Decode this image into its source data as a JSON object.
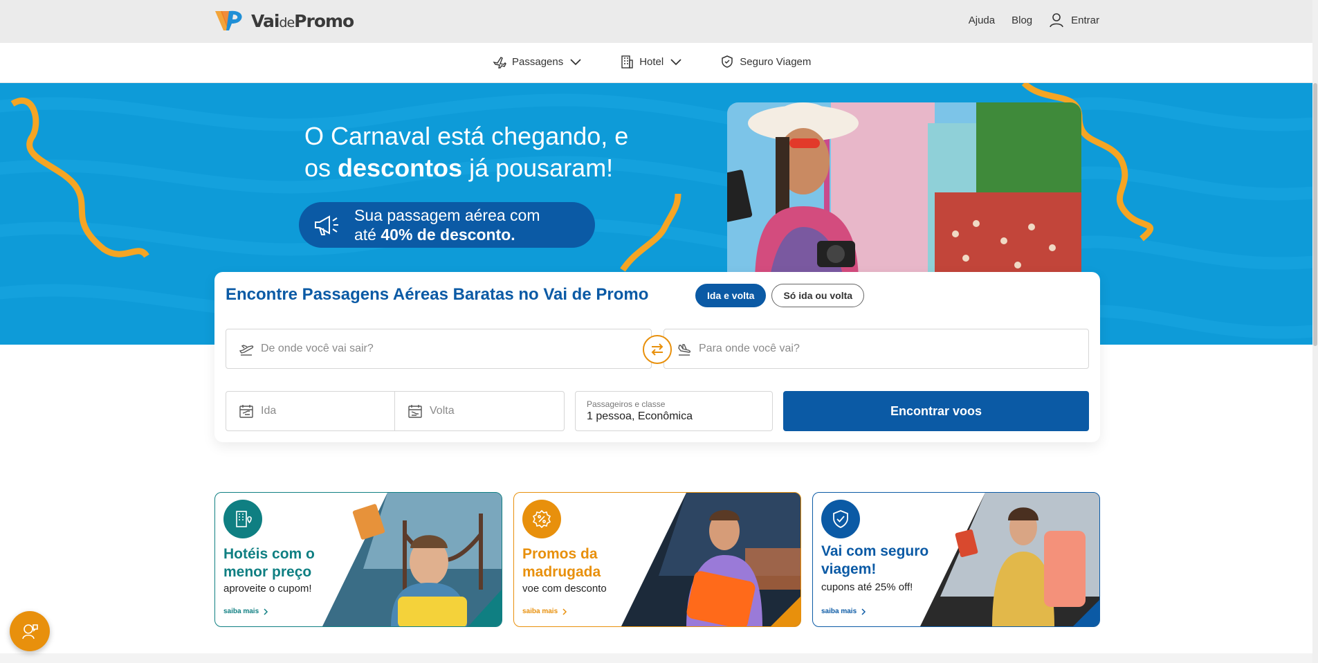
{
  "header": {
    "logo_text_vai": "Vai",
    "logo_text_de": "de",
    "logo_text_promo": "Promo",
    "links": {
      "ajuda": "Ajuda",
      "blog": "Blog",
      "entrar": "Entrar"
    }
  },
  "subnav": {
    "items": [
      {
        "label": "Passagens",
        "icon": "airplane-icon",
        "dropdown": true
      },
      {
        "label": "Hotel",
        "icon": "building-icon",
        "dropdown": true
      },
      {
        "label": "Seguro Viagem",
        "icon": "shield-icon",
        "dropdown": false
      }
    ]
  },
  "hero": {
    "title_line1": "O Carnaval está chegando, e",
    "title_line2_pre": "os ",
    "title_line2_bold": "descontos",
    "title_line2_post": " já pousaram!",
    "promo_line1": "Sua passagem aérea com",
    "promo_line2_pre": "até ",
    "promo_line2_bold": "40% de desconto.",
    "bg_color": "#0e9bd8"
  },
  "search": {
    "title": "Encontre Passagens Aéreas Baratas no Vai de Promo",
    "trip_types": {
      "round": "Ida e volta",
      "oneway": "Só ida ou volta"
    },
    "selected_trip": "round",
    "origin_placeholder": "De onde você vai sair?",
    "destination_placeholder": "Para onde você vai?",
    "depart_placeholder": "Ida",
    "return_placeholder": "Volta",
    "passengers_label": "Passageiros e classe",
    "passengers_value": "1 pessoa, Econômica",
    "submit_label": "Encontrar voos"
  },
  "cards": [
    {
      "title": "Hotéis com o menor preço",
      "subtitle": "aproveite o cupom!",
      "more": "saiba mais",
      "color": "#0f7f82",
      "icon": "hotel-icon"
    },
    {
      "title": "Promos da madrugada",
      "subtitle": "voe com desconto",
      "more": "saiba mais",
      "color": "#e8900c",
      "icon": "discount-badge-icon"
    },
    {
      "title": "Vai com seguro viagem!",
      "subtitle": "cupons até 25% off!",
      "more": "saiba mais",
      "color": "#0b5aa5",
      "icon": "shield-check-icon"
    }
  ],
  "colors": {
    "brand_blue": "#0b5aa5",
    "accent_orange": "#e8900c",
    "teal": "#0f7f82"
  }
}
